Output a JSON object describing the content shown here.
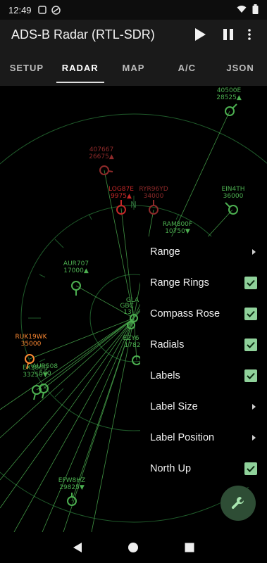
{
  "status_bar": {
    "time": "12:49"
  },
  "app_bar": {
    "title": "ADS-B Radar (RTL-SDR)"
  },
  "tabs": [
    {
      "label": "SETUP",
      "active": false
    },
    {
      "label": "RADAR",
      "active": true
    },
    {
      "label": "MAP",
      "active": false
    },
    {
      "label": "A/C",
      "active": false
    },
    {
      "label": "JSON",
      "active": false
    }
  ],
  "radar": {
    "compass_north": "N",
    "colors": {
      "green": "#4caf50",
      "red": "#c62828",
      "orange": "#ff8a33",
      "ring": "#1f5a2a"
    },
    "aircraft": [
      {
        "callsign": "40500E",
        "altitude": "28525▲",
        "color": "green"
      },
      {
        "callsign": "407667",
        "altitude": "26675▲",
        "color": "dim"
      },
      {
        "callsign": "LOG87E",
        "altitude": "9975▲",
        "color": "red"
      },
      {
        "callsign": "RYR96YD",
        "altitude": "34000",
        "color": "dim"
      },
      {
        "callsign": "EIN4TH",
        "altitude": "36000",
        "color": "green"
      },
      {
        "callsign": "RAM800F",
        "altitude": "10750▼",
        "color": "green"
      },
      {
        "callsign": "AUR707",
        "altitude": "17000▲",
        "color": "green"
      },
      {
        "callsign": "RUK19WK",
        "altitude": "35000",
        "color": "orange"
      },
      {
        "callsign": "EXS86Q",
        "altitude": "33250▼",
        "color": "green"
      },
      {
        "callsign": "EFW8HZ",
        "altitude": "29825▼",
        "color": "green"
      }
    ],
    "partial_labels": [
      {
        "text": "GLA",
        "color": "green"
      },
      {
        "text": "GBC",
        "color": "green"
      },
      {
        "text": "13",
        "color": "green"
      },
      {
        "text": "EZY6",
        "color": "green"
      },
      {
        "text": "1782",
        "color": "green"
      },
      {
        "text": "AUR508",
        "color": "green"
      },
      {
        "text": "500",
        "color": "green"
      }
    ]
  },
  "menu": {
    "items": [
      {
        "label": "Range",
        "type": "submenu"
      },
      {
        "label": "Range Rings",
        "type": "checkbox",
        "checked": true
      },
      {
        "label": "Compass Rose",
        "type": "checkbox",
        "checked": true
      },
      {
        "label": "Radials",
        "type": "checkbox",
        "checked": true
      },
      {
        "label": "Labels",
        "type": "checkbox",
        "checked": true
      },
      {
        "label": "Label Size",
        "type": "submenu"
      },
      {
        "label": "Label Position",
        "type": "submenu"
      },
      {
        "label": "North Up",
        "type": "checkbox",
        "checked": true
      }
    ]
  },
  "fab": {
    "icon": "wrench-icon"
  }
}
